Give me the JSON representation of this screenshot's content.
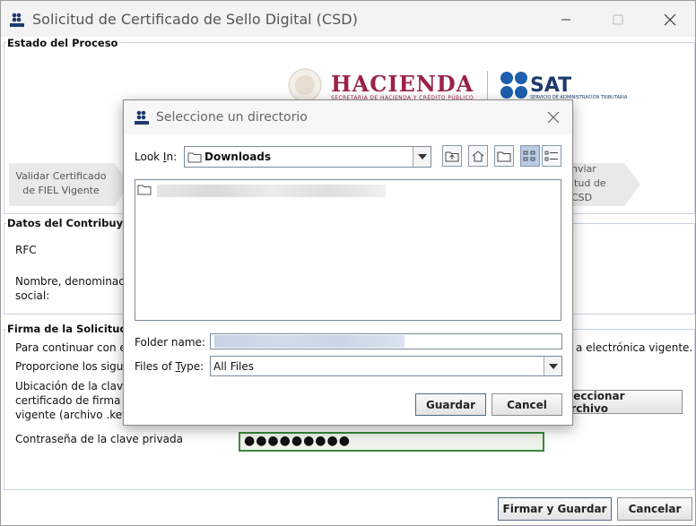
{
  "window": {
    "title": "Solicitud de Certificado de Sello Digital (CSD)"
  },
  "estado": {
    "title": "Estado del Proceso",
    "logo_hacienda": "HACIENDA",
    "logo_hacienda_sub": "SECRETARÍA DE HACIENDA Y CRÉDITO PÚBLICO",
    "logo_sat": "SAT",
    "logo_sat_sub": "SERVICIO DE ADMINISTRACIÓN TRIBUTARIA",
    "step1_line1": "Validar Certificado",
    "step1_line2": "de FIEL Vigente",
    "step3_line1": "nviar",
    "step3_line2": "itud de",
    "step3_line3": "CSD"
  },
  "contribuyente": {
    "title": "Datos del Contribuyent",
    "rfc_label": "RFC",
    "nombre_label_line1": "Nombre, denominació",
    "nombre_label_line2": "social:"
  },
  "firma": {
    "title": "Firma de la Solicitud",
    "line1_left": "Para continuar con el",
    "line1_right": "a electrónica vigente.",
    "line2_left": "Proporcione los siguie",
    "ubicacion_line1": "Ubicación de la clave",
    "ubicacion_line2": "certificado de firma e",
    "ubicacion_line3": "vigente (archivo .key)",
    "seleccionar_button": "eleccionar Archivo",
    "password_label": "Contraseña de la clave privada",
    "password_value": "●●●●●●●●●"
  },
  "footer": {
    "firmar_button": "Firmar y Guardar",
    "cancelar_button": "Cancelar"
  },
  "dialog": {
    "title": "Seleccione un directorio",
    "look_in_label_pre": "Look ",
    "look_in_label_u": "I",
    "look_in_label_post": "n:",
    "look_in_value": "Downloads",
    "folder_name_label": "Folder name:",
    "files_of_type_label_pre": "Files of ",
    "files_of_type_label_u": "T",
    "files_of_type_label_post": "ype:",
    "files_of_type_value": "All Files",
    "guardar_button": "Guardar",
    "cancel_button": "Cancel"
  }
}
